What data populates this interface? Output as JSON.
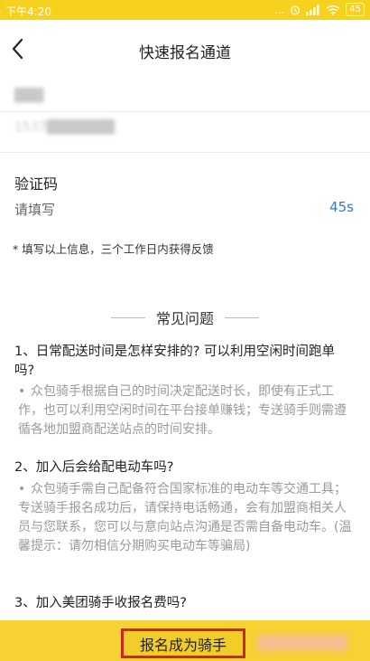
{
  "status_bar": {
    "time": "下午4:20",
    "signal_text": "...",
    "battery": "45"
  },
  "nav": {
    "title": "快速报名通道"
  },
  "form": {
    "name_value": "███",
    "phone_value": "1537███████",
    "code_label": "验证码",
    "code_placeholder": "请填写",
    "countdown": "45s",
    "notice": "* 填写以上信息，三个工作日内获得反馈"
  },
  "faq": {
    "title": "常见问题",
    "items": [
      {
        "question": "1、日常配送时间是怎样安排的? 可以利用空闲时间跑单吗?",
        "answer": "众包骑手根据自己的时间决定配送时长，即使有正式工作，也可以利用空闲时间在平台接单赚钱；专送骑手则需遵循各地加盟商配送站点的时间安排。"
      },
      {
        "question": "2、加入后会给配电动车吗?",
        "answer": "众包骑手需自己配备符合国家标准的电动车等交通工具；专送骑手报名成功后，请保持电话畅通，会有加盟商相关人员与您联系，您可以与意向站点沟通是否需自备电动车。(温馨提示：请勿相信分期购买电动车等骗局)"
      },
      {
        "question": "3、加入美团骑手收报名费吗?"
      }
    ]
  },
  "cta": {
    "label": "报名成为骑手"
  },
  "colors": {
    "accent": "#f6d21e",
    "countdown": "#2e7bd6",
    "highlight_border": "#d02424"
  }
}
